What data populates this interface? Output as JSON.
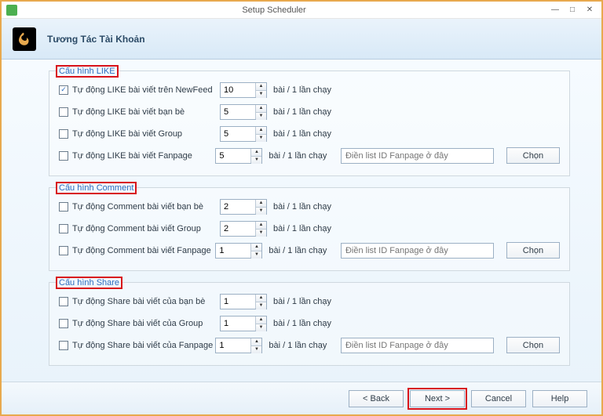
{
  "window": {
    "title": "Setup Scheduler",
    "header": "Tương Tác Tài Khoản"
  },
  "groups": {
    "like": {
      "legend": "Cấu hình LIKE",
      "rows": [
        {
          "label": "Tự động LIKE bài viết trên NewFeed",
          "value": "10",
          "unit": "bài / 1 lần chạy",
          "checked": true
        },
        {
          "label": "Tự động LIKE bài viết bạn bè",
          "value": "5",
          "unit": "bài / 1 lần chạy",
          "checked": false
        },
        {
          "label": "Tự động LIKE bài viết Group",
          "value": "5",
          "unit": "bài / 1 lần chạy",
          "checked": false
        },
        {
          "label": "Tự động LIKE bài viết Fanpage",
          "value": "5",
          "unit": "bài / 1 lần chạy",
          "checked": false
        }
      ],
      "fanpage_placeholder": "Điền list ID Fanpage ở đây",
      "choose": "Chọn"
    },
    "comment": {
      "legend": "Cấu hình Comment",
      "rows": [
        {
          "label": "Tự động Comment bài viết bạn bè",
          "value": "2",
          "unit": "bài / 1 lần chạy",
          "checked": false
        },
        {
          "label": "Tự động Comment bài viết Group",
          "value": "2",
          "unit": "bài / 1 lần chạy",
          "checked": false
        },
        {
          "label": "Tự động Comment bài viết Fanpage",
          "value": "1",
          "unit": "bài / 1 lần chạy",
          "checked": false
        }
      ],
      "fanpage_placeholder": "Điền list ID Fanpage ở đây",
      "choose": "Chọn"
    },
    "share": {
      "legend": "Cấu hình Share",
      "rows": [
        {
          "label": "Tự động Share bài viết của bạn bè",
          "value": "1",
          "unit": "bài / 1 lần chạy",
          "checked": false
        },
        {
          "label": "Tự động Share bài viết của Group",
          "value": "1",
          "unit": "bài / 1 lần chạy",
          "checked": false
        },
        {
          "label": "Tự động Share bài viết của Fanpage",
          "value": "1",
          "unit": "bài / 1 lần chạy",
          "checked": false
        }
      ],
      "fanpage_placeholder": "Điền list ID Fanpage ở đây",
      "choose": "Chọn"
    }
  },
  "footer": {
    "back": "< Back",
    "next": "Next >",
    "cancel": "Cancel",
    "help": "Help"
  }
}
